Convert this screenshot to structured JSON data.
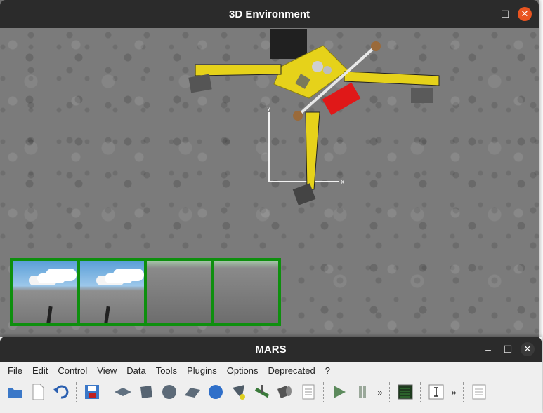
{
  "window3d": {
    "title": "3D Environment"
  },
  "overlay": {
    "axis_x_label": "x",
    "axis_y_label": "y"
  },
  "camera_views": [
    {
      "kind": "sky"
    },
    {
      "kind": "sky"
    },
    {
      "kind": "ground"
    },
    {
      "kind": "ground"
    }
  ],
  "mars": {
    "title": "MARS",
    "menu": [
      "File",
      "Edit",
      "Control",
      "View",
      "Data",
      "Tools",
      "Plugins",
      "Options",
      "Deprecated",
      "?"
    ],
    "overflow_1": "»",
    "overflow_2": "»"
  },
  "window_controls": {
    "minimize": "–",
    "maximize": "☐",
    "close": "✕"
  },
  "colors": {
    "titlebar": "#2b2b2b",
    "close": "#e95420",
    "camera_border": "#0e8f0e",
    "robot_yellow": "#e6d21a"
  }
}
